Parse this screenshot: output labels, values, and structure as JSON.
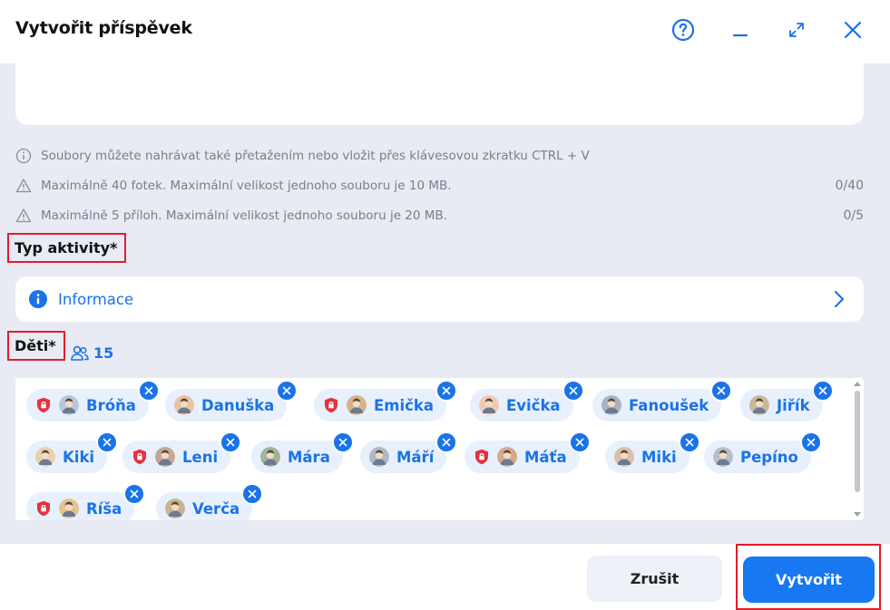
{
  "dialog": {
    "title": "Vytvořit příspěvek"
  },
  "header_icons": {
    "help": "help-circle-icon",
    "minimize": "minimize-icon",
    "maximize": "expand-icon",
    "close": "close-icon"
  },
  "notes": [
    {
      "icon": "info-circle-icon",
      "text": "Soubory můžete nahrávat také přetažením nebo vložit přes klávesovou zkratku CTRL + V",
      "count": ""
    },
    {
      "icon": "warning-triangle-icon",
      "text": "Maximálně 40 fotek. Maximální velikost jednoho souboru je 10 MB.",
      "count": "0/40"
    },
    {
      "icon": "warning-triangle-icon",
      "text": "Maximálně 5 příloh. Maximální velikost jednoho souboru je 20 MB.",
      "count": "0/5"
    }
  ],
  "activity": {
    "label": "Typ aktivity*",
    "value": "Informace"
  },
  "children": {
    "label": "Děti*",
    "count": "15",
    "items": [
      {
        "name": "Bróňa",
        "protected": true
      },
      {
        "name": "Danuška",
        "protected": false
      },
      {
        "name": "Emička",
        "protected": true
      },
      {
        "name": "Evička",
        "protected": false
      },
      {
        "name": "Fanoušek",
        "protected": false
      },
      {
        "name": "Jiřík",
        "protected": false
      },
      {
        "name": "Kiki",
        "protected": false
      },
      {
        "name": "Leni",
        "protected": true
      },
      {
        "name": "Mára",
        "protected": false
      },
      {
        "name": "Máří",
        "protected": false
      },
      {
        "name": "Máťa",
        "protected": true
      },
      {
        "name": "Miki",
        "protected": false
      },
      {
        "name": "Pepíno",
        "protected": false
      },
      {
        "name": "Ríša",
        "protected": true
      },
      {
        "name": "Verča",
        "protected": false
      }
    ]
  },
  "footer": {
    "cancel_label": "Zrušit",
    "create_label": "Vytvořit"
  },
  "colors": {
    "accent": "#1778f2",
    "highlight": "#e11d2a",
    "chip_bg": "#e7f0fc",
    "panel_bg": "#e8eaf4"
  }
}
